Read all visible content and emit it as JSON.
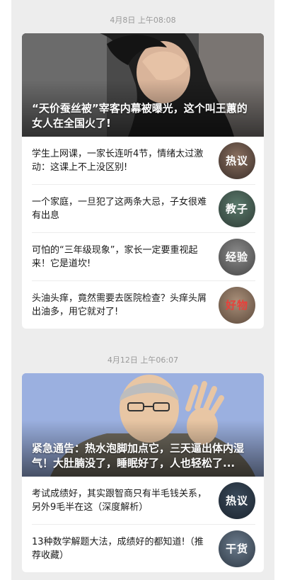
{
  "feed": [
    {
      "timestamp": "4月8日 上午08:08",
      "cover_title": "“天价蚕丝被”宰客内幕被曝光，这个叫王蕙的女人在全国火了!",
      "items": [
        {
          "text": "学生上网课，一家长连听4节，情绪太过激动：这课上不上没区别!",
          "thumb_label": "热议"
        },
        {
          "text": "一个家庭，一旦犯了这两条大忌，子女很难有出息",
          "thumb_label": "教子"
        },
        {
          "text": "可怕的“三年级现象”，家长一定要重视起来！它是道坎!",
          "thumb_label": "经验"
        },
        {
          "text": "头油头痒，竟然需要去医院检查？头痒头屑出油多，用它就对了!",
          "thumb_label": "好物"
        }
      ]
    },
    {
      "timestamp": "4月12日 上午06:07",
      "cover_title": "紧急通告：热水泡脚加点它，三天逼出体内湿气！大肚腩没了，睡眠好了，人也轻松了...",
      "items": [
        {
          "text": "考试成绩好，其实跟智商只有半毛钱关系，另外9毛半在这（深度解析）",
          "thumb_label": "热议"
        },
        {
          "text": "13种数学解题大法，成绩好的都知道!（推荐收藏）",
          "thumb_label": "干货"
        }
      ]
    }
  ],
  "colors": {
    "feed_bg": "#ededed",
    "card_bg": "#ffffff",
    "timestamp": "#9a9a9a",
    "thumb_good_stuff_text": "#e8403a"
  },
  "icons": {
    "cover_1": "woman-covering-face-photo",
    "cover_2": "doctor-illustration",
    "thumbs": "circular-thumbnail"
  }
}
